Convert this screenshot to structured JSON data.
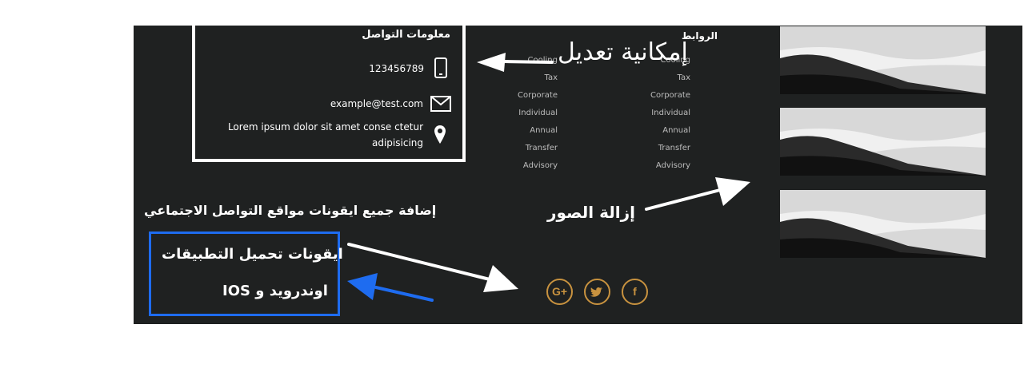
{
  "contact": {
    "title": "معلومات التواصل",
    "phone": "123456789",
    "email": "example@test.com",
    "address_line1": "Lorem ipsum dolor sit amet conse ctetur",
    "address_line2": "adipisicing",
    "phone_icon": "phone-icon",
    "email_icon": "envelope-icon",
    "location_icon": "location-pin-icon"
  },
  "links": {
    "title": "الروابط",
    "col_left": [
      "Cooling",
      "Tax",
      "Corporate",
      "Individual",
      "Annual",
      "Transfer",
      "Advisory"
    ],
    "col_right": [
      "Cooling",
      "Tax",
      "Corporate",
      "Individual",
      "Annual",
      "Transfer",
      "Advisory"
    ]
  },
  "annotations": {
    "edit_possible": "إمكانية تعديل",
    "remove_images": "إزالة الصور",
    "add_social": "إضافة  جميع ايقونات مواقع التواصل الاجتماعي",
    "app_icons_line1": "ايقونات تحميل التطبيقات",
    "app_icons_line2": "اوندرويد و IOS"
  },
  "social": {
    "google_label": "G+",
    "twitter_label": "🐦",
    "facebook_label": "f",
    "icons": [
      "google-plus-icon",
      "twitter-icon",
      "facebook-icon"
    ]
  },
  "colors": {
    "panel_bg": "#1f2121",
    "social_gold": "#c8923f",
    "annotation_blue": "#1e6cf0"
  }
}
